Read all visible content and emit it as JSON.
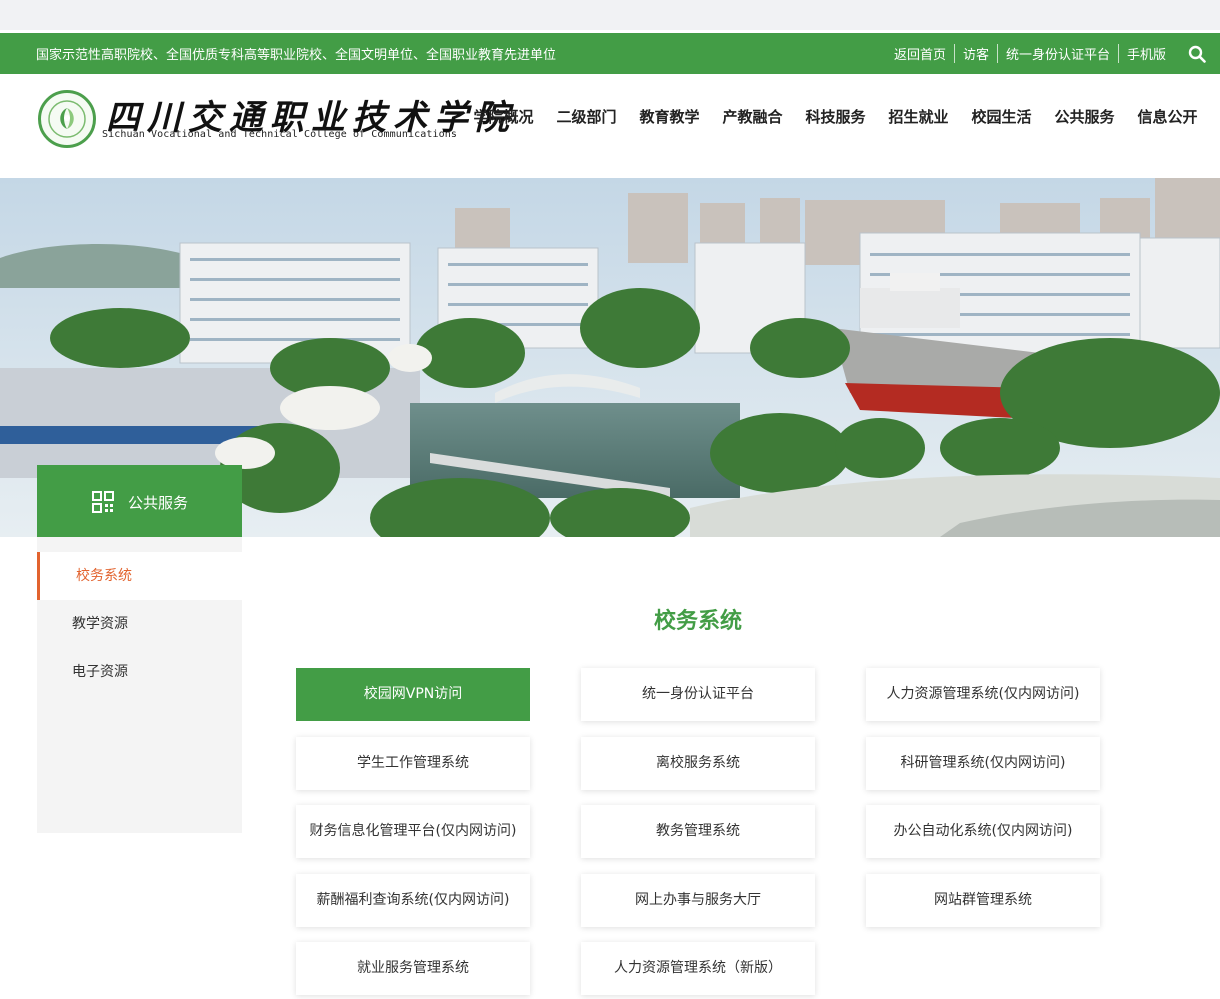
{
  "top_bar": {
    "honors": "国家示范性高职院校、全国优质专科高等职业院校、全国文明单位、全国职业教育先进单位",
    "links": [
      "返回首页",
      "访客",
      "统一身份认证平台",
      "手机版"
    ]
  },
  "logo": {
    "name_cn": "四川交通职业技术学院",
    "name_en": "Sichuan Vocational and Technical College of Communications"
  },
  "nav": [
    "学院概况",
    "二级部门",
    "教育教学",
    "产教融合",
    "科技服务",
    "招生就业",
    "校园生活",
    "公共服务",
    "信息公开"
  ],
  "sidebar": {
    "title": "公共服务",
    "items": [
      {
        "label": "校务系统",
        "active": true
      },
      {
        "label": "教学资源",
        "active": false
      },
      {
        "label": "电子资源",
        "active": false
      }
    ]
  },
  "page_title": "校务系统",
  "cards": [
    "校园网VPN访问",
    "统一身份认证平台",
    "人力资源管理系统(仅内网访问)",
    "学生工作管理系统",
    "离校服务系统",
    "科研管理系统(仅内网访问)",
    "财务信息化管理平台(仅内网访问)",
    "教务管理系统",
    "办公自动化系统(仅内网访问)",
    "薪酬福利查询系统(仅内网访问)",
    "网上办事与服务大厅",
    "网站群管理系统",
    "就业服务管理系统",
    "人力资源管理系统（新版）"
  ],
  "colors": {
    "brand_green": "#439d46",
    "active_orange": "#e2632e"
  }
}
